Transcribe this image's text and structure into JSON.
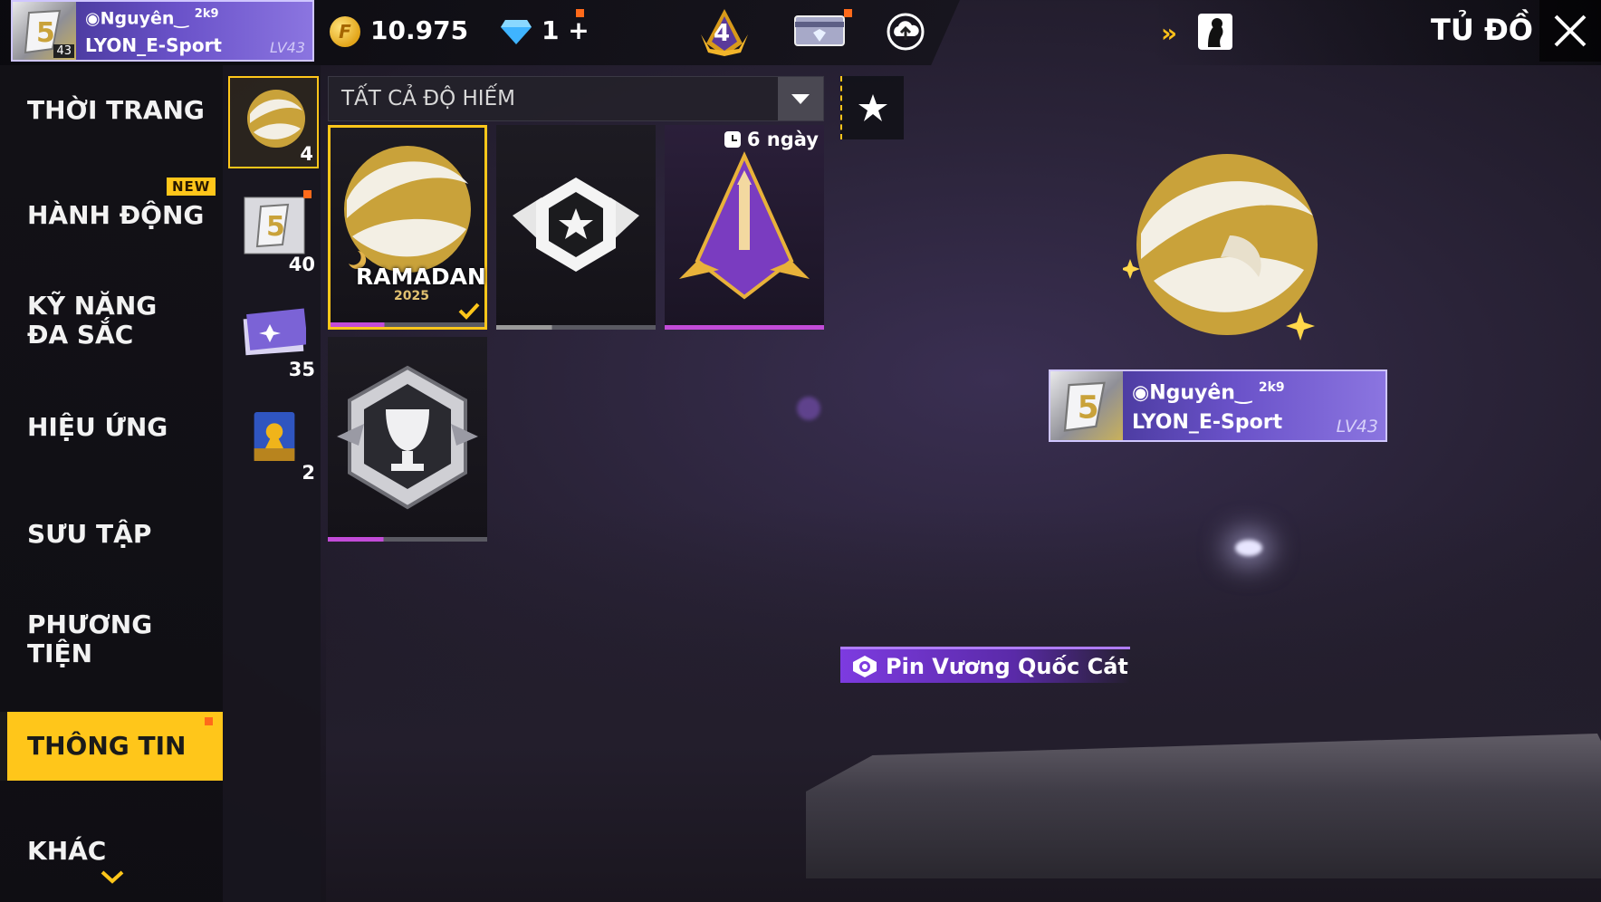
{
  "profile": {
    "name": "Nguyên",
    "name_suffix": "2k9",
    "guild": "LYON_E-Sport",
    "level": "LV43",
    "avatar_level": "43"
  },
  "currency": {
    "gold": "10.975",
    "diamonds": "1"
  },
  "rank_badge": "4",
  "page_title": "TỦ ĐỒ",
  "categories": [
    {
      "label": "THỜI TRANG"
    },
    {
      "label": "HÀNH ĐỘNG",
      "badge": "NEW"
    },
    {
      "label": "KỸ NĂNG ĐA SẮC"
    },
    {
      "label": "HIỆU ỨNG"
    },
    {
      "label": "SƯU TẬP"
    },
    {
      "label": "PHƯƠNG TIỆN"
    },
    {
      "label": "THÔNG TIN",
      "active": true
    },
    {
      "label": "KHÁC"
    }
  ],
  "subcategories": [
    {
      "icon": "pin-orb-icon",
      "count": "4",
      "active": true
    },
    {
      "icon": "avatar-frame-icon",
      "count": "40"
    },
    {
      "icon": "banner-card-icon",
      "count": "35"
    },
    {
      "icon": "character-card-icon",
      "count": "2"
    }
  ],
  "filter": {
    "label": "TẤT CẢ ĐỘ HIẾM"
  },
  "items": [
    {
      "icon": "ramadan-pin-icon",
      "text": "RAMADAN",
      "year": "2025",
      "selected": true,
      "bar_fill": 0.35,
      "bar_color": "#c24bd8"
    },
    {
      "icon": "star-wings-pin-icon",
      "bar_fill": 0.35,
      "bar_color": "#9a9a9a"
    },
    {
      "icon": "sword-pin-icon",
      "timer": "6 ngày",
      "bar_fill": 1.0,
      "bar_color": "#c24bd8"
    },
    {
      "icon": "trophy-pin-icon",
      "bar_fill": 0.35,
      "bar_color": "#c24bd8"
    }
  ],
  "preview": {
    "item_name": "Pin Vương Quốc Cát"
  },
  "colors": {
    "accent": "#ffc61a",
    "rarity_purple": "#c24bd8",
    "profile_purple": "#6a52c9"
  }
}
